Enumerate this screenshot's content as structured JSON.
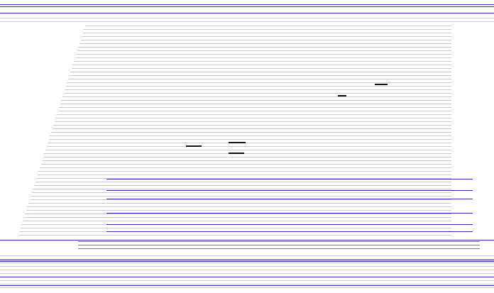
{
  "header": {
    "brand": "",
    "links": [],
    "cta": ""
  },
  "colors": {
    "accent": "#2c2ca8",
    "rule": "#c8c8d2"
  },
  "note": ""
}
